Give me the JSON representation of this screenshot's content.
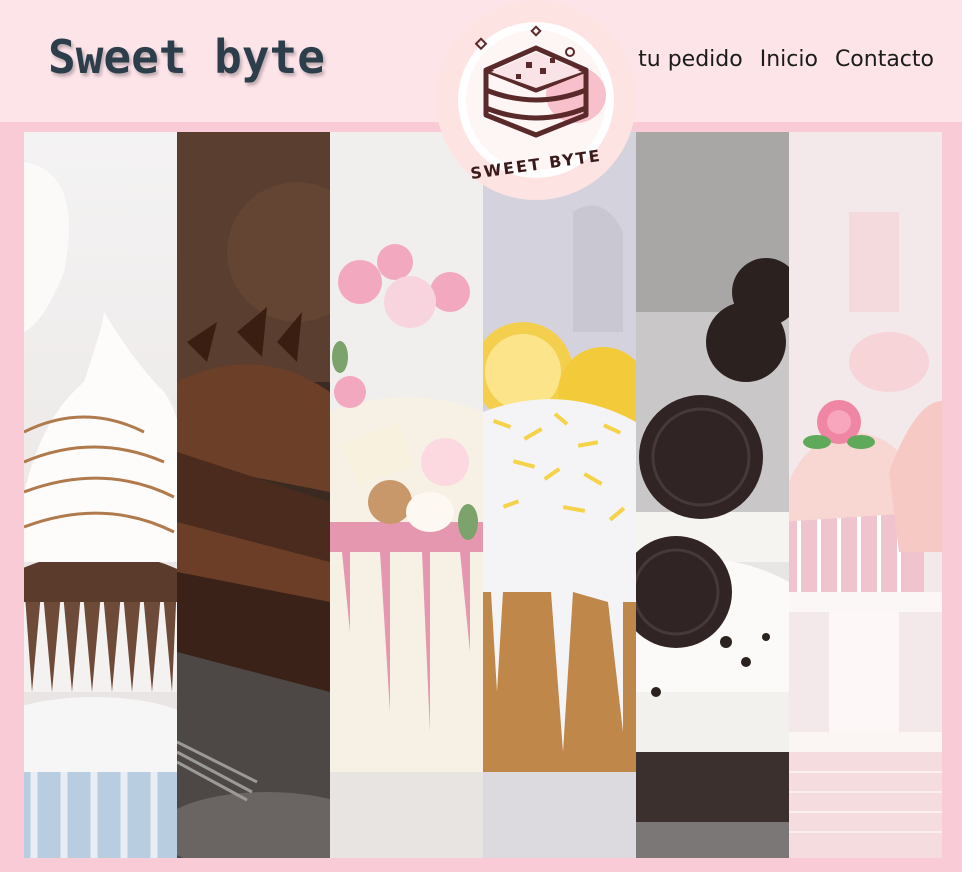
{
  "header": {
    "brand": "Sweet byte",
    "nav": [
      "tu pedido",
      "Inicio",
      "Contacto"
    ]
  },
  "logo": {
    "text": "SWEET BYTE",
    "icon": "cake-slice-logo-icon"
  },
  "gallery": {
    "panels": [
      {
        "name": "meringue-cupcake-image",
        "subject": "cupcake with toasted meringue"
      },
      {
        "name": "chocolate-cake-image",
        "subject": "chocolate layer cake slice"
      },
      {
        "name": "drip-cake-image",
        "subject": "white drip cake with pink decorations"
      },
      {
        "name": "lemon-cake-image",
        "subject": "lemon glazed cake"
      },
      {
        "name": "oreo-dessert-image",
        "subject": "oreo cream dessert cups"
      },
      {
        "name": "rose-cupcake-image",
        "subject": "pink rose cupcakes"
      }
    ]
  },
  "colors": {
    "header_bg": "#fde4e9",
    "page_bg": "#f8cbd6",
    "brand_text": "#2d3e4b",
    "logo_outline": "#5a2a2a",
    "logo_accent": "#f4a9b8"
  }
}
